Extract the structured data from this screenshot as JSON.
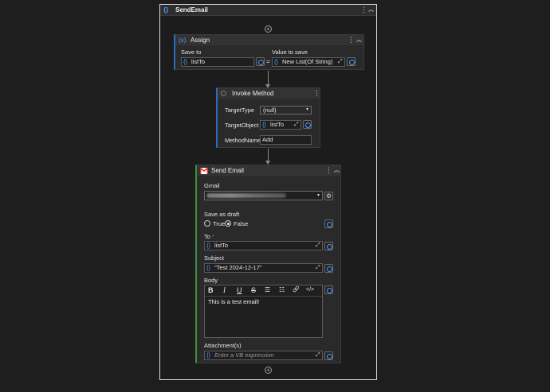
{
  "sequence": {
    "title": "SendEmail"
  },
  "assign": {
    "title": "Assign",
    "save_to_label": "Save to",
    "value_label": "Value to save",
    "save_to_value": "listTo",
    "value_value": "New List(Of String)",
    "equals": "="
  },
  "invoke": {
    "title": "Invoke Method",
    "target_type_label": "TargetType",
    "target_type_value": "(null)",
    "target_object_label": "TargetObject",
    "target_object_value": "listTo",
    "method_name_label": "MethodName",
    "method_name_value": "Add"
  },
  "send_email": {
    "title": "Send Email",
    "gmail_label": "Gmail",
    "save_draft_label": "Save as draft",
    "true_label": "True",
    "false_label": "False",
    "to_label": "To",
    "to_required": "*",
    "to_value": "listTo",
    "subject_label": "Subject",
    "subject_value": "\"Test 2024-12-17\"",
    "body_label": "Body",
    "body_text": "This is a test email!",
    "attachments_label": "Attachment(s)",
    "attachments_placeholder": "Enter a VB expression"
  },
  "glyphs": {
    "braces": "{}",
    "kebab": "⋮",
    "collapse": "︽",
    "plus": "+",
    "expand": "⤢",
    "dropdown": "▾",
    "gear": "⚙",
    "bold": "B",
    "italic": "I",
    "underline": "U",
    "strike": "S",
    "bullets": "☰",
    "numbers": "☷",
    "link": "🔗",
    "code": "</>"
  },
  "colors": {
    "accent": "#4a9eff",
    "required": "#e05a5a"
  }
}
